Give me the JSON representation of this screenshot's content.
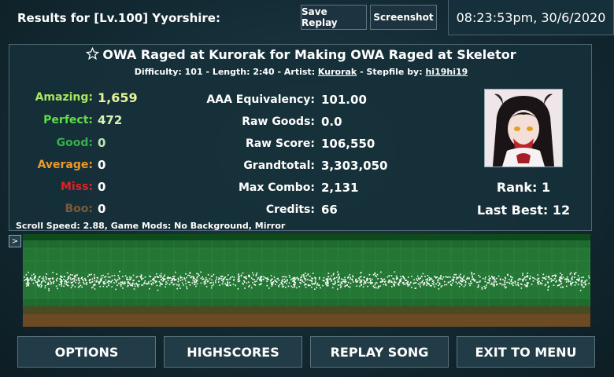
{
  "header": {
    "title": "Results for [Lv.100] Yyorshire:",
    "save_replay_label": "Save Replay",
    "screenshot_label": "Screenshot",
    "datetime": "08:23:53pm, 30/6/2020"
  },
  "song": {
    "title": "OWA Raged at Kurorak for Making OWA Raged at Skeletor",
    "difficulty_text": "Difficulty: 101 - Length: 2:40 - Artist: ",
    "artist": "Kurorak",
    "stepfile_text": " - Stepfile by: ",
    "stepfile_author": "hi19hi19"
  },
  "judgements": [
    {
      "label": "Amazing:",
      "value": "1,659",
      "color": "#a8e85a",
      "val_color": "#e4f59a"
    },
    {
      "label": "Perfect:",
      "value": "472",
      "color": "#62dd4a",
      "val_color": "#d7f4b4"
    },
    {
      "label": "Good:",
      "value": "0",
      "color": "#34b14a",
      "val_color": "#b9e6b0"
    },
    {
      "label": "Average:",
      "value": "0",
      "color": "#ec9a2a",
      "val_color": "#ffffff"
    },
    {
      "label": "Miss:",
      "value": "0",
      "color": "#e02222",
      "val_color": "#ffffff"
    },
    {
      "label": "Boo:",
      "value": "0",
      "color": "#7d5a36",
      "val_color": "#ffffff"
    }
  ],
  "stats": [
    {
      "label": "AAA Equivalency:",
      "value": "101.00"
    },
    {
      "label": "Raw Goods:",
      "value": "0.0"
    },
    {
      "label": "Raw Score:",
      "value": "106,550"
    },
    {
      "label": "Grandtotal:",
      "value": "3,303,050"
    },
    {
      "label": "Max Combo:",
      "value": "2,131"
    },
    {
      "label": "Credits:",
      "value": "66"
    }
  ],
  "rank": {
    "rank_text": "Rank: 1",
    "last_best_text": "Last Best: 12"
  },
  "scroll_info": "Scroll Speed: 2.88, Game Mods: No Background, Mirror",
  "graph": {
    "toggle_label": ">"
  },
  "buttons": {
    "options": "OPTIONS",
    "highscores": "HIGHSCORES",
    "replay": "REPLAY SONG",
    "exit": "EXIT TO MENU"
  },
  "colors": {
    "panel_border": "#4e6772",
    "graph_green": "#1f6a2f",
    "graph_dark_green": "#0f4a1d",
    "graph_brown": "#6b4a24"
  }
}
